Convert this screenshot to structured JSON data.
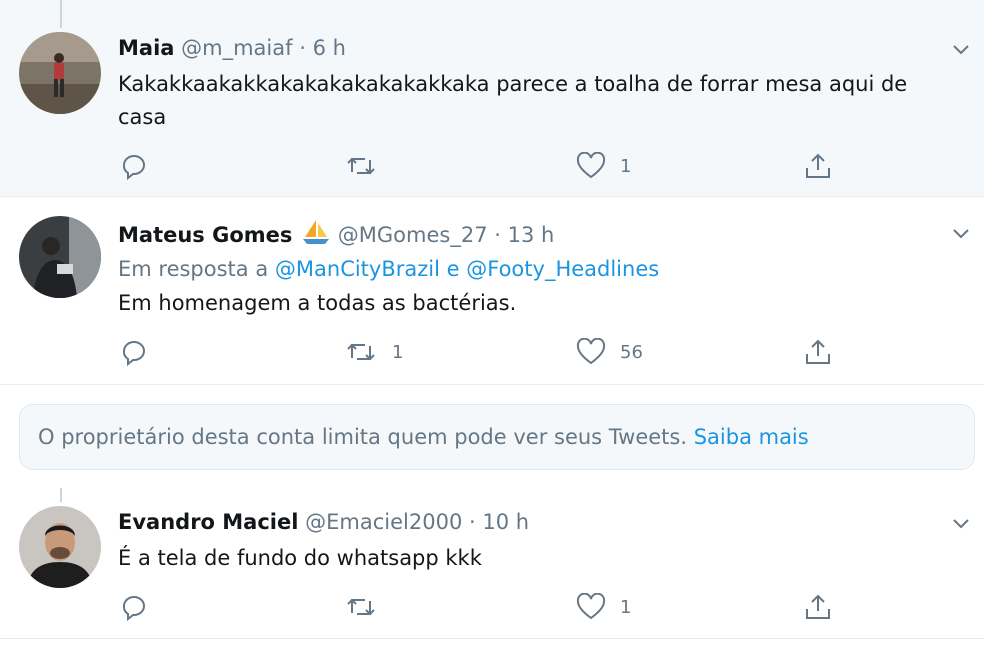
{
  "tweets": [
    {
      "name": "Maia",
      "handle": "@m_maiaf",
      "time": "6 h",
      "text_line1": "Kakakkaakakkakakakakakakakkaka parece a toalha de forrar mesa aqui de",
      "text_line2": "casa",
      "retweets": "",
      "likes": "1"
    },
    {
      "name": "Mateus Gomes",
      "badge": "sailboat-emoji",
      "handle": "@MGomes_27",
      "time": "13 h",
      "reply_prefix": "Em resposta a",
      "reply_mention1": "@ManCityBrazil",
      "reply_and": "e",
      "reply_mention2": "@Footy_Headlines",
      "text": "Em homenagem a todas as bactérias.",
      "retweets": "1",
      "likes": "56"
    },
    {
      "name": "Evandro Maciel",
      "handle": "@Emaciel2000",
      "time": "10 h",
      "text": "É a tela de fundo do whatsapp kkk",
      "retweets": "",
      "likes": "1"
    }
  ],
  "notice": {
    "text": "O proprietário desta conta limita quem pode ver seus Tweets.",
    "link": "Saiba mais"
  },
  "separator": "·",
  "colors": {
    "link": "#1b95e0",
    "secondary": "#657786",
    "highlight_bg": "#f5f8fa"
  }
}
